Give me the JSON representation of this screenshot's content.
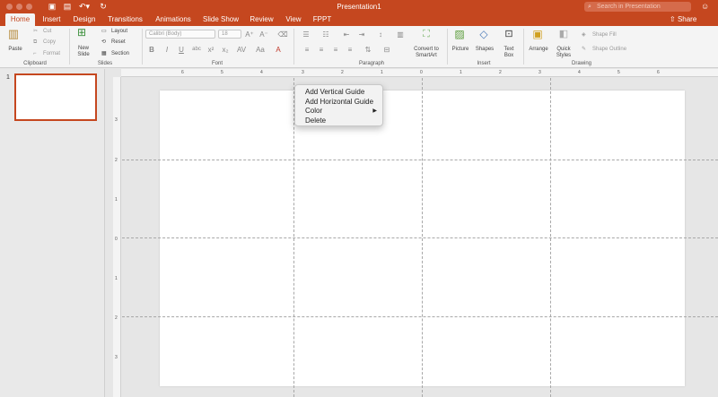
{
  "window": {
    "title": "Presentation1",
    "search_placeholder": "Search in Presentation"
  },
  "toolbar_icons": [
    "sidebar-icon",
    "save-icon",
    "undo-icon",
    "redo-icon"
  ],
  "tabs": [
    {
      "label": "Home",
      "active": true
    },
    {
      "label": "Insert"
    },
    {
      "label": "Design"
    },
    {
      "label": "Transitions"
    },
    {
      "label": "Animations"
    },
    {
      "label": "Slide Show"
    },
    {
      "label": "Review"
    },
    {
      "label": "View"
    },
    {
      "label": "FPPT"
    }
  ],
  "share_label": "Share",
  "ribbon": {
    "clipboard": {
      "paste": "Paste",
      "cut": "Cut",
      "copy": "Copy",
      "format": "Format",
      "group": "Clipboard"
    },
    "slides": {
      "new_slide_line1": "New",
      "new_slide_line2": "Slide",
      "layout": "Layout",
      "reset": "Reset",
      "section": "Section",
      "group": "Slides"
    },
    "font": {
      "name": "Calibri (Body)",
      "size": "18",
      "group": "Font"
    },
    "paragraph": {
      "group": "Paragraph",
      "smartart_line1": "Convert to",
      "smartart_line2": "SmartArt"
    },
    "insert": {
      "picture": "Picture",
      "shapes": "Shapes",
      "textbox_line1": "Text",
      "textbox_line2": "Box",
      "group": "Insert"
    },
    "drawing": {
      "arrange": "Arrange",
      "quick_styles_line1": "Quick",
      "quick_styles_line2": "Styles",
      "shape_fill": "Shape Fill",
      "shape_outline": "Shape Outline",
      "group": "Drawing"
    }
  },
  "slides_pane": {
    "slide_number": "1"
  },
  "hruler_numbers": [
    "6",
    "5",
    "4",
    "3",
    "2",
    "1",
    "0",
    "1",
    "2",
    "3",
    "4",
    "5",
    "6"
  ],
  "vruler_numbers": [
    "3",
    "2",
    "1",
    "0",
    "1",
    "2",
    "3"
  ],
  "context_menu": {
    "items": [
      {
        "label": "Add Vertical Guide"
      },
      {
        "label": "Add Horizontal Guide"
      },
      {
        "label": "Color",
        "submenu": true
      },
      {
        "label": "Delete"
      }
    ]
  },
  "colors": {
    "accent": "#c5471f",
    "ribbon_bg": "#f4f4f4",
    "canvas_bg": "#e6e6e6"
  }
}
